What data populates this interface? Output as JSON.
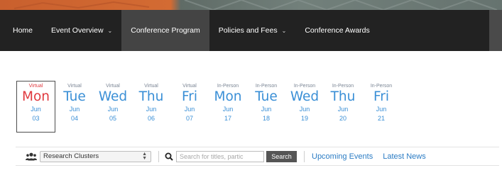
{
  "colors": {
    "nav_background": "#222222",
    "nav_active": "#444444",
    "day_link": "#3a8fd6",
    "day_selected": "#e0393e",
    "link": "#2b7cc4",
    "search_button": "#555555"
  },
  "nav": {
    "items": [
      {
        "label": "Home",
        "dropdown": false,
        "active": false
      },
      {
        "label": "Event Overview",
        "dropdown": true,
        "active": false
      },
      {
        "label": "Conference Program",
        "dropdown": false,
        "active": true
      },
      {
        "label": "Policies and Fees",
        "dropdown": true,
        "active": false
      },
      {
        "label": "Conference Awards",
        "dropdown": false,
        "active": false
      }
    ],
    "caret_icon": "chevron-down-icon"
  },
  "days": [
    {
      "mode": "Virtual",
      "day": "Mon",
      "month": "Jun",
      "date": "03",
      "selected": true
    },
    {
      "mode": "Virtual",
      "day": "Tue",
      "month": "Jun",
      "date": "04",
      "selected": false
    },
    {
      "mode": "Virtual",
      "day": "Wed",
      "month": "Jun",
      "date": "05",
      "selected": false
    },
    {
      "mode": "Virtual",
      "day": "Thu",
      "month": "Jun",
      "date": "06",
      "selected": false
    },
    {
      "mode": "Virtual",
      "day": "Fri",
      "month": "Jun",
      "date": "07",
      "selected": false
    },
    {
      "mode": "In-Person",
      "day": "Mon",
      "month": "Jun",
      "date": "17",
      "selected": false
    },
    {
      "mode": "In-Person",
      "day": "Tue",
      "month": "Jun",
      "date": "18",
      "selected": false
    },
    {
      "mode": "In-Person",
      "day": "Wed",
      "month": "Jun",
      "date": "19",
      "selected": false
    },
    {
      "mode": "In-Person",
      "day": "Thu",
      "month": "Jun",
      "date": "20",
      "selected": false
    },
    {
      "mode": "In-Person",
      "day": "Fri",
      "month": "Jun",
      "date": "21",
      "selected": false
    }
  ],
  "filter": {
    "group_icon": "users-icon",
    "select_value": "Research Clusters",
    "search_icon": "search-icon",
    "search_placeholder": "Search for titles, partic",
    "search_button": "Search",
    "links": [
      "Upcoming Events",
      "Latest News"
    ]
  }
}
